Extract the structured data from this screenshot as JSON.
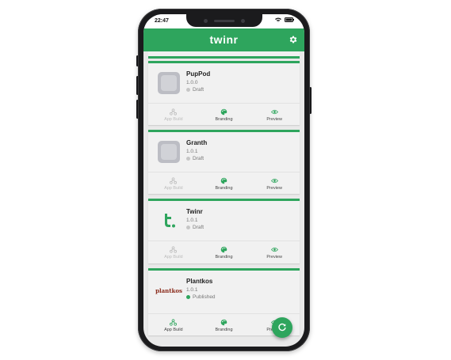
{
  "statusbar": {
    "time": "22:47"
  },
  "appbar": {
    "logo_text": "twinr"
  },
  "apps": [
    {
      "name": "PupPod",
      "version": "1.0.0",
      "status": "Draft",
      "published": false,
      "icon": "placeholder-app-icon"
    },
    {
      "name": "Granth",
      "version": "1.0.1",
      "status": "Draft",
      "published": false,
      "icon": "placeholder-app-icon"
    },
    {
      "name": "Twinr",
      "version": "1.0.1",
      "status": "Draft",
      "published": false,
      "icon": "twinr-t-logo"
    },
    {
      "name": "Plantkos",
      "version": "1.0.1",
      "status": "Published",
      "published": true,
      "icon": "plantkos-logo",
      "logo_text": "plantkos"
    }
  ],
  "actions": {
    "app_build": "App Build",
    "branding": "Branding",
    "preview": "Preview"
  },
  "colors": {
    "brand_green": "#2ea55d",
    "disabled_gray": "#bdbdbd"
  }
}
